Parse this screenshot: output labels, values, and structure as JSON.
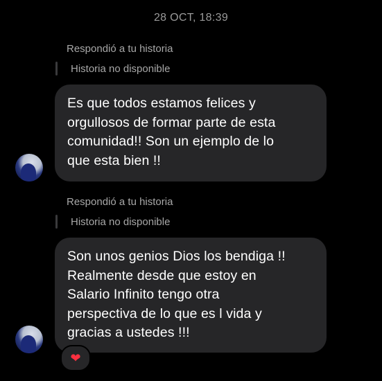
{
  "conversation": {
    "timestamp": "28 OCT, 18:39",
    "messages": [
      {
        "reply_label": "Respondió a tu historia",
        "story_status": "Historia no disponible",
        "lines": [
          "Es que todos estamos felices y",
          "orgullosos de formar parte de esta",
          "comunidad!! Son un ejemplo de lo",
          "que esta bien !!"
        ]
      },
      {
        "reply_label": "Respondió a tu historia",
        "story_status": "Historia no disponible",
        "lines": [
          "Son unos genios Dios los bendiga !!",
          "Realmente desde que estoy en",
          "Salario Infinito tengo otra",
          "perspectiva de lo que es l vida y",
          "gracias a ustedes !!!"
        ],
        "reaction": "❤"
      }
    ]
  },
  "colors": {
    "background": "#000000",
    "bubble": "#262628",
    "secondary_text": "#a8a8a8",
    "heart": "#ff3040"
  }
}
